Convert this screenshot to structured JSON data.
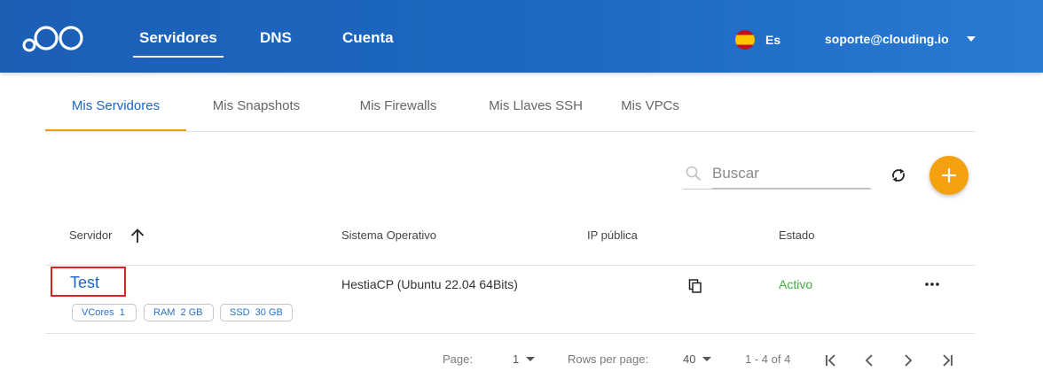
{
  "header": {
    "nav": [
      {
        "label": "Servidores",
        "active": true
      },
      {
        "label": "DNS",
        "active": false
      },
      {
        "label": "Cuenta",
        "active": false
      }
    ],
    "language": "Es",
    "language_flag_icon": "spain-flag-icon",
    "account_email": "soporte@clouding.io",
    "accent_color": "#1d68c2"
  },
  "tabs": [
    {
      "label": "Mis Servidores",
      "active": true
    },
    {
      "label": "Mis Snapshots",
      "active": false
    },
    {
      "label": "Mis Firewalls",
      "active": false
    },
    {
      "label": "Mis Llaves SSH",
      "active": false
    },
    {
      "label": "Mis VPCs",
      "active": false
    }
  ],
  "search": {
    "placeholder": "Buscar",
    "value": ""
  },
  "table": {
    "columns": {
      "server": "Servidor",
      "os": "Sistema Operativo",
      "ip": "IP pública",
      "status": "Estado"
    },
    "rows": [
      {
        "name": "Test",
        "specs": {
          "vcores_label": "VCores",
          "vcores": "1",
          "ram_label": "RAM",
          "ram": "2 GB",
          "ssd_label": "SSD",
          "ssd": "30 GB"
        },
        "os": "HestiaCP (Ubuntu 22.04 64Bits)",
        "ip": "",
        "status": "Activo",
        "status_color": "#3cae3c"
      }
    ]
  },
  "pagination": {
    "page_label": "Page:",
    "page": "1",
    "rows_per_page_label": "Rows per page:",
    "rows_per_page": "40",
    "range": "1 - 4 of 4"
  },
  "colors": {
    "add_button": "#f5a10e",
    "active_tab_underline": "#f39c12",
    "highlight_box": "#e02020"
  }
}
